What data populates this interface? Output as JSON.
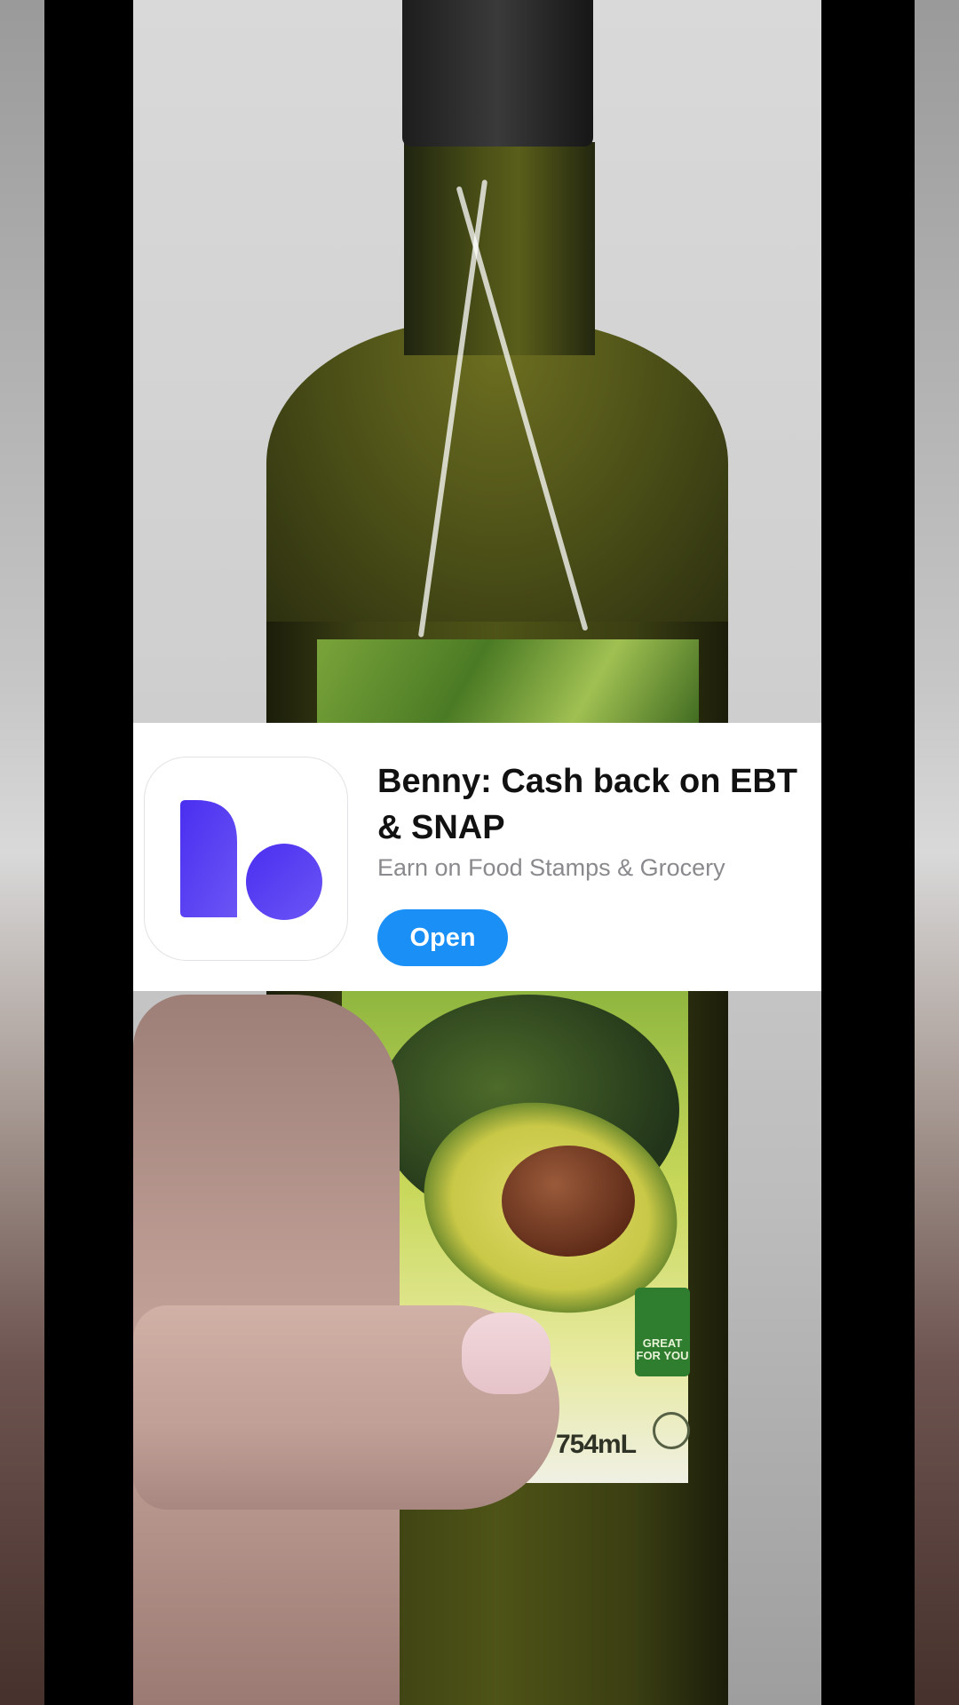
{
  "app_banner": {
    "title": "Benny: Cash back on EBT\n& SNAP",
    "subtitle": "Earn on Food Stamps & Grocery",
    "open_label": "Open",
    "icon": "benny-logo-icon",
    "accent_color": "#1a90f7",
    "logo_color": "#5a3df0"
  },
  "video": {
    "label_badge": "GREAT\nFOR YOU",
    "volume_text": "OZ) 754mL"
  }
}
